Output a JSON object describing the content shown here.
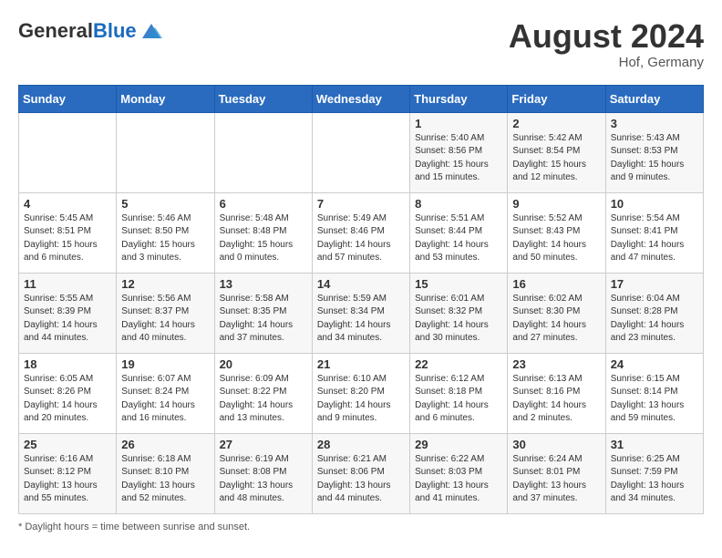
{
  "header": {
    "logo_general": "General",
    "logo_blue": "Blue",
    "month_year": "August 2024",
    "location": "Hof, Germany"
  },
  "footer": {
    "note": "Daylight hours"
  },
  "days_of_week": [
    "Sunday",
    "Monday",
    "Tuesday",
    "Wednesday",
    "Thursday",
    "Friday",
    "Saturday"
  ],
  "weeks": [
    [
      {
        "day": "",
        "info": ""
      },
      {
        "day": "",
        "info": ""
      },
      {
        "day": "",
        "info": ""
      },
      {
        "day": "",
        "info": ""
      },
      {
        "day": "1",
        "info": "Sunrise: 5:40 AM\nSunset: 8:56 PM\nDaylight: 15 hours\nand 15 minutes."
      },
      {
        "day": "2",
        "info": "Sunrise: 5:42 AM\nSunset: 8:54 PM\nDaylight: 15 hours\nand 12 minutes."
      },
      {
        "day": "3",
        "info": "Sunrise: 5:43 AM\nSunset: 8:53 PM\nDaylight: 15 hours\nand 9 minutes."
      }
    ],
    [
      {
        "day": "4",
        "info": "Sunrise: 5:45 AM\nSunset: 8:51 PM\nDaylight: 15 hours\nand 6 minutes."
      },
      {
        "day": "5",
        "info": "Sunrise: 5:46 AM\nSunset: 8:50 PM\nDaylight: 15 hours\nand 3 minutes."
      },
      {
        "day": "6",
        "info": "Sunrise: 5:48 AM\nSunset: 8:48 PM\nDaylight: 15 hours\nand 0 minutes."
      },
      {
        "day": "7",
        "info": "Sunrise: 5:49 AM\nSunset: 8:46 PM\nDaylight: 14 hours\nand 57 minutes."
      },
      {
        "day": "8",
        "info": "Sunrise: 5:51 AM\nSunset: 8:44 PM\nDaylight: 14 hours\nand 53 minutes."
      },
      {
        "day": "9",
        "info": "Sunrise: 5:52 AM\nSunset: 8:43 PM\nDaylight: 14 hours\nand 50 minutes."
      },
      {
        "day": "10",
        "info": "Sunrise: 5:54 AM\nSunset: 8:41 PM\nDaylight: 14 hours\nand 47 minutes."
      }
    ],
    [
      {
        "day": "11",
        "info": "Sunrise: 5:55 AM\nSunset: 8:39 PM\nDaylight: 14 hours\nand 44 minutes."
      },
      {
        "day": "12",
        "info": "Sunrise: 5:56 AM\nSunset: 8:37 PM\nDaylight: 14 hours\nand 40 minutes."
      },
      {
        "day": "13",
        "info": "Sunrise: 5:58 AM\nSunset: 8:35 PM\nDaylight: 14 hours\nand 37 minutes."
      },
      {
        "day": "14",
        "info": "Sunrise: 5:59 AM\nSunset: 8:34 PM\nDaylight: 14 hours\nand 34 minutes."
      },
      {
        "day": "15",
        "info": "Sunrise: 6:01 AM\nSunset: 8:32 PM\nDaylight: 14 hours\nand 30 minutes."
      },
      {
        "day": "16",
        "info": "Sunrise: 6:02 AM\nSunset: 8:30 PM\nDaylight: 14 hours\nand 27 minutes."
      },
      {
        "day": "17",
        "info": "Sunrise: 6:04 AM\nSunset: 8:28 PM\nDaylight: 14 hours\nand 23 minutes."
      }
    ],
    [
      {
        "day": "18",
        "info": "Sunrise: 6:05 AM\nSunset: 8:26 PM\nDaylight: 14 hours\nand 20 minutes."
      },
      {
        "day": "19",
        "info": "Sunrise: 6:07 AM\nSunset: 8:24 PM\nDaylight: 14 hours\nand 16 minutes."
      },
      {
        "day": "20",
        "info": "Sunrise: 6:09 AM\nSunset: 8:22 PM\nDaylight: 14 hours\nand 13 minutes."
      },
      {
        "day": "21",
        "info": "Sunrise: 6:10 AM\nSunset: 8:20 PM\nDaylight: 14 hours\nand 9 minutes."
      },
      {
        "day": "22",
        "info": "Sunrise: 6:12 AM\nSunset: 8:18 PM\nDaylight: 14 hours\nand 6 minutes."
      },
      {
        "day": "23",
        "info": "Sunrise: 6:13 AM\nSunset: 8:16 PM\nDaylight: 14 hours\nand 2 minutes."
      },
      {
        "day": "24",
        "info": "Sunrise: 6:15 AM\nSunset: 8:14 PM\nDaylight: 13 hours\nand 59 minutes."
      }
    ],
    [
      {
        "day": "25",
        "info": "Sunrise: 6:16 AM\nSunset: 8:12 PM\nDaylight: 13 hours\nand 55 minutes."
      },
      {
        "day": "26",
        "info": "Sunrise: 6:18 AM\nSunset: 8:10 PM\nDaylight: 13 hours\nand 52 minutes."
      },
      {
        "day": "27",
        "info": "Sunrise: 6:19 AM\nSunset: 8:08 PM\nDaylight: 13 hours\nand 48 minutes."
      },
      {
        "day": "28",
        "info": "Sunrise: 6:21 AM\nSunset: 8:06 PM\nDaylight: 13 hours\nand 44 minutes."
      },
      {
        "day": "29",
        "info": "Sunrise: 6:22 AM\nSunset: 8:03 PM\nDaylight: 13 hours\nand 41 minutes."
      },
      {
        "day": "30",
        "info": "Sunrise: 6:24 AM\nSunset: 8:01 PM\nDaylight: 13 hours\nand 37 minutes."
      },
      {
        "day": "31",
        "info": "Sunrise: 6:25 AM\nSunset: 7:59 PM\nDaylight: 13 hours\nand 34 minutes."
      }
    ]
  ]
}
